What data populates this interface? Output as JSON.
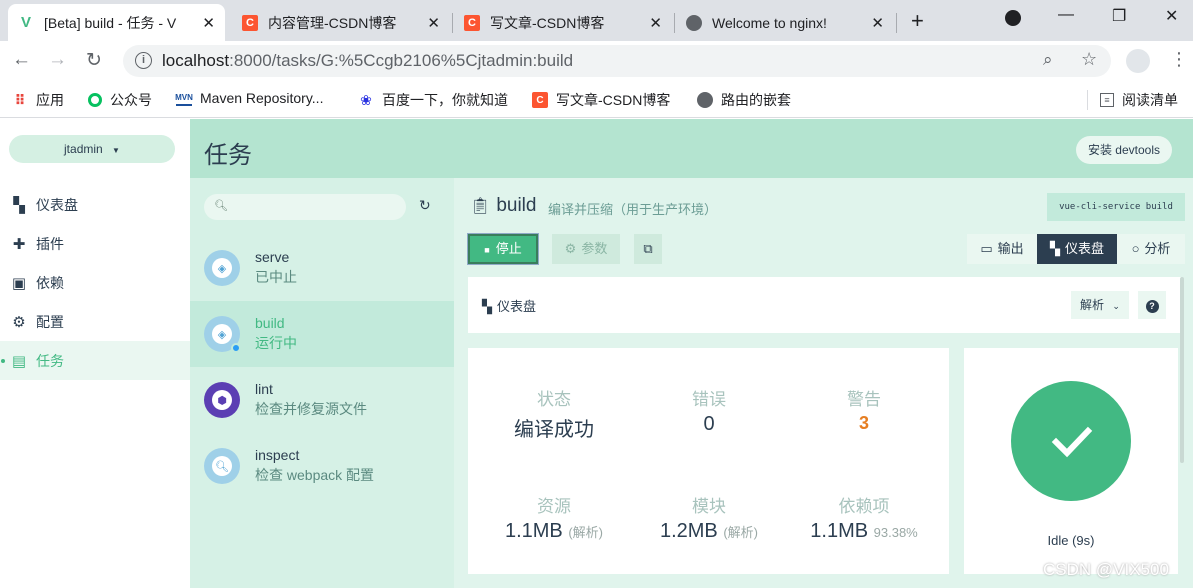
{
  "browser": {
    "tabs": [
      {
        "title": "[Beta] build - 任务 - V",
        "icon": "vue-icon",
        "active": true
      },
      {
        "title": "内容管理-CSDN博客",
        "icon": "csdn-icon"
      },
      {
        "title": "写文章-CSDN博客",
        "icon": "csdn-icon"
      },
      {
        "title": "Welcome to nginx!",
        "icon": "globe-icon"
      }
    ],
    "url_host": "localhost",
    "url_path": ":8000/tasks/G:%5Ccgb2106%5Cjtadmin:build",
    "bookmarks": [
      {
        "label": "应用",
        "icon": "apps-icon"
      },
      {
        "label": "公众号",
        "icon": "wechat-icon"
      },
      {
        "label": "Maven Repository...",
        "icon": "mvn-icon",
        "icon_text": "MVN"
      },
      {
        "label": "百度一下，你就知道",
        "icon": "baidu-icon"
      },
      {
        "label": "写文章-CSDN博客",
        "icon": "csdn-icon",
        "icon_text": "C"
      },
      {
        "label": "路由的嵌套",
        "icon": "globe-icon"
      }
    ],
    "reading_list": "阅读清单"
  },
  "sidebar": {
    "project": "jtadmin",
    "items": [
      {
        "label": "仪表盘",
        "icon": "dashboard-icon"
      },
      {
        "label": "插件",
        "icon": "puzzle-icon"
      },
      {
        "label": "依赖",
        "icon": "library-icon"
      },
      {
        "label": "配置",
        "icon": "settings-icon"
      },
      {
        "label": "任务",
        "icon": "task-icon",
        "active": true
      }
    ]
  },
  "header": {
    "title": "任务",
    "devtools_label": "安装 devtools"
  },
  "tasks": [
    {
      "name": "serve",
      "desc": "已中止"
    },
    {
      "name": "build",
      "desc": "运行中",
      "active": true
    },
    {
      "name": "lint",
      "desc": "检查并修复源文件"
    },
    {
      "name": "inspect",
      "desc": "检查 webpack 配置"
    }
  ],
  "detail": {
    "title": "build",
    "subtitle": "编译并压缩（用于生产环境）",
    "command": "vue-cli-service build",
    "stop_label": "停止",
    "params_label": "参数",
    "views": [
      {
        "label": "输出",
        "icon": "terminal-icon"
      },
      {
        "label": "仪表盘",
        "icon": "dashboard-icon",
        "active": true
      },
      {
        "label": "分析",
        "icon": "analyze-icon"
      }
    ],
    "dashboard_label": "仪表盘",
    "analyze_select": "解析",
    "stats": [
      {
        "label": "状态",
        "value": "编译成功"
      },
      {
        "label": "错误",
        "value": "0"
      },
      {
        "label": "警告",
        "value": "3"
      },
      {
        "label": "资源",
        "value": "1.1MB",
        "note": "(解析)"
      },
      {
        "label": "模块",
        "value": "1.2MB",
        "note": "(解析)"
      },
      {
        "label": "依赖项",
        "value": "1.1MB",
        "note": "93.38%"
      }
    ],
    "idle_text": "Idle (9s)"
  },
  "watermark": "CSDN @VIX500"
}
